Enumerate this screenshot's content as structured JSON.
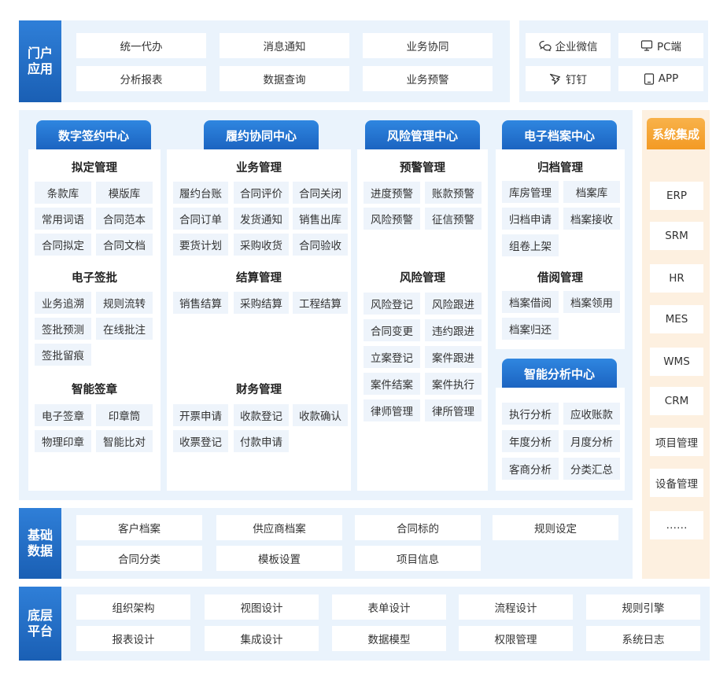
{
  "portal": {
    "label": "门户应用",
    "cells": [
      "统一代办",
      "消息通知",
      "业务协同",
      "分析报表",
      "数据查询",
      "业务预警"
    ],
    "channels": [
      {
        "icon": "chat-bubble-icon",
        "label": "企业微信"
      },
      {
        "icon": "monitor-icon",
        "label": "PC端"
      },
      {
        "icon": "dingtalk-icon",
        "label": "钉钉"
      },
      {
        "icon": "mobile-icon",
        "label": "APP"
      }
    ]
  },
  "centers": {
    "sign": {
      "title": "数字签约中心",
      "groups": [
        {
          "title": "拟定管理",
          "items": [
            "条款库",
            "模版库",
            "常用词语",
            "合同范本",
            "合同拟定",
            "合同文档"
          ]
        },
        {
          "title": "电子签批",
          "items": [
            "业务追溯",
            "规则流转",
            "签批预测",
            "在线批注",
            "签批留痕"
          ]
        },
        {
          "title": "智能签章",
          "items": [
            "电子签章",
            "印章筒",
            "物理印章",
            "智能比对"
          ]
        }
      ]
    },
    "perform": {
      "title": "履约协同中心",
      "groups": [
        {
          "title": "业务管理",
          "items": [
            "履约台账",
            "合同评价",
            "合同关闭",
            "合同订单",
            "发货通知",
            "销售出库",
            "要货计划",
            "采购收货",
            "合同验收"
          ]
        },
        {
          "title": "结算管理",
          "items": [
            "销售结算",
            "采购结算",
            "工程结算"
          ]
        },
        {
          "title": "财务管理",
          "items": [
            "开票申请",
            "收款登记",
            "收款确认",
            "收票登记",
            "付款申请"
          ]
        }
      ]
    },
    "risk": {
      "title": "风险管理中心",
      "groups": [
        {
          "title": "预警管理",
          "items": [
            "进度预警",
            "账款预警",
            "风险预警",
            "征信预警"
          ]
        },
        {
          "title": "风险管理",
          "items": [
            "风险登记",
            "风险跟进",
            "合同变更",
            "违约跟进",
            "立案登记",
            "案件跟进",
            "案件结案",
            "案件执行",
            "律师管理",
            "律所管理"
          ]
        }
      ]
    },
    "archive": {
      "title": "电子档案中心",
      "groups": [
        {
          "title": "归档管理",
          "items": [
            "库房管理",
            "档案库",
            "归档申请",
            "档案接收",
            "组卷上架"
          ]
        },
        {
          "title": "借阅管理",
          "items": [
            "档案借阅",
            "档案领用",
            "档案归还"
          ]
        }
      ]
    },
    "analysis": {
      "title": "智能分析中心",
      "items": [
        "执行分析",
        "应收账款",
        "年度分析",
        "月度分析",
        "客商分析",
        "分类汇总"
      ]
    }
  },
  "systems": {
    "title": "系统集成",
    "items": [
      "ERP",
      "SRM",
      "HR",
      "MES",
      "WMS",
      "CRM",
      "项目管理",
      "设备管理",
      "……"
    ]
  },
  "base": {
    "label": "基础数据",
    "cells": [
      "客户档案",
      "供应商档案",
      "合同标的",
      "规则设定",
      "合同分类",
      "模板设置",
      "项目信息"
    ]
  },
  "platform": {
    "label": "底层平台",
    "cells": [
      "组织架构",
      "视图设计",
      "表单设计",
      "流程设计",
      "规则引擎",
      "报表设计",
      "集成设计",
      "数据模型",
      "权限管理",
      "系统日志"
    ]
  },
  "colors": {
    "primary": "#1b63c0",
    "band": "#eaf3fc",
    "pill": "#eef4fb",
    "accent": "#f39a24",
    "accentBand": "#fdf0e0"
  }
}
